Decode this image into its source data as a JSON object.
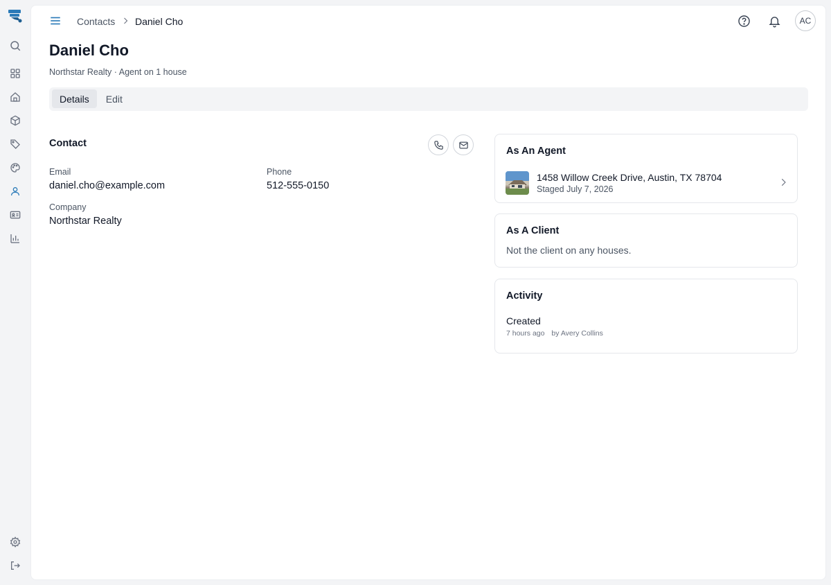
{
  "breadcrumb": {
    "parent": "Contacts",
    "current": "Daniel Cho"
  },
  "header": {
    "avatar_initials": "AC"
  },
  "page": {
    "title": "Daniel Cho",
    "subtitle": "Northstar Realty · Agent on 1 house"
  },
  "tabs": [
    {
      "label": "Details",
      "active": true
    },
    {
      "label": "Edit",
      "active": false
    }
  ],
  "contact": {
    "title": "Contact",
    "email_label": "Email",
    "email_value": "daniel.cho@example.com",
    "phone_label": "Phone",
    "phone_value": "512-555-0150",
    "company_label": "Company",
    "company_value": "Northstar Realty"
  },
  "as_agent": {
    "title": "As An Agent",
    "houses": [
      {
        "address": "1458 Willow Creek Drive, Austin, TX 78704",
        "status": "Staged July 7, 2026"
      }
    ]
  },
  "as_client": {
    "title": "As A Client",
    "empty_text": "Not the client on any houses."
  },
  "activity": {
    "title": "Activity",
    "events": [
      {
        "action": "Created",
        "time": "7 hours ago",
        "by": "by Avery Collins"
      }
    ]
  },
  "icons": {
    "rail": [
      "search-icon",
      "dashboard-icon",
      "home-icon",
      "box-icon",
      "tag-icon",
      "palette-icon",
      "user-icon",
      "contact-card-icon",
      "chart-icon",
      "settings-icon",
      "logout-icon"
    ],
    "header": [
      "menu-icon",
      "help-icon",
      "bell-icon"
    ]
  },
  "colors": {
    "accent": "#2a7ab8",
    "background": "#f3f4f6",
    "panel": "#ffffff"
  }
}
